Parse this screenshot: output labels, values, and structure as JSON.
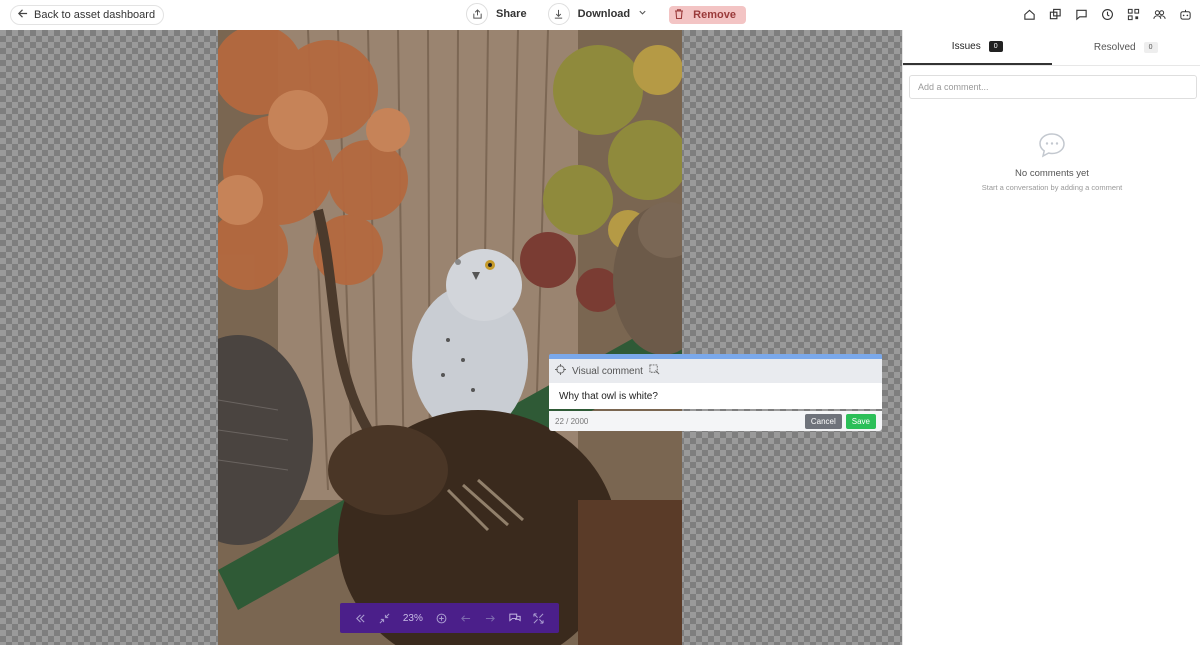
{
  "topbar": {
    "back_label": "Back to asset dashboard",
    "share_label": "Share",
    "download_label": "Download",
    "remove_label": "Remove",
    "icons": [
      "home-icon",
      "copy-icon",
      "comment-icon",
      "clock-icon",
      "qr-code-icon",
      "users-icon",
      "robot-icon"
    ]
  },
  "comment_popup": {
    "header_label": "Visual comment",
    "text": "Why that owl is white?",
    "count": "22 / 2000",
    "cancel_label": "Cancel",
    "save_label": "Save"
  },
  "zoombar": {
    "zoom": "23%"
  },
  "panel": {
    "tabs": [
      {
        "label": "Issues",
        "count": "0"
      },
      {
        "label": "Resolved",
        "count": "0"
      }
    ],
    "comment_placeholder": "Add a comment...",
    "empty_title": "No comments yet",
    "empty_subtitle": "Start a conversation by adding a comment"
  },
  "colors": {
    "accent": "#4b1f8a",
    "save_green": "#2bbf58",
    "remove_red": "#f3c4c4",
    "popup_blue": "#7aa8ea"
  }
}
